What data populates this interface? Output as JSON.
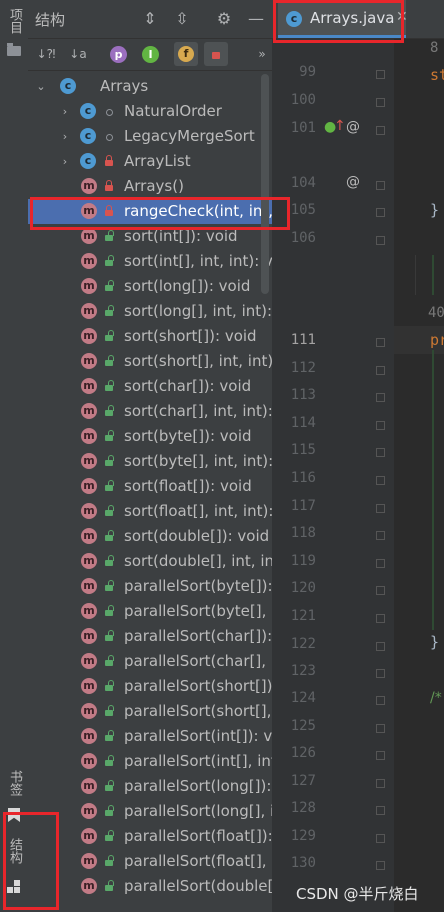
{
  "left_strip": {
    "project_label": "项目",
    "bookmarks_label": "书签",
    "structure_label": "结构"
  },
  "structure_panel": {
    "title": "结构",
    "header_icons": [
      "expand-all-icon",
      "collapse-all-icon",
      "gear-icon",
      "minimize-icon"
    ],
    "toolbar": {
      "sort_visibility_label": "↓⁈",
      "sort_alpha_label": "↓a",
      "show_properties": "p",
      "show_inherited": "I",
      "show_fields": "f",
      "show_non_public": "lock",
      "more": "»"
    },
    "root": {
      "label": "Arrays",
      "icon": "class-icon"
    },
    "items": [
      {
        "label": "NaturalOrder",
        "icon": "class-icon",
        "expandable": true,
        "visibility": "package"
      },
      {
        "label": "LegacyMergeSort",
        "icon": "class-icon",
        "expandable": true,
        "visibility": "package"
      },
      {
        "label": "ArrayList",
        "icon": "class-icon",
        "expandable": true,
        "visibility": "private"
      },
      {
        "label": "Arrays()",
        "icon": "method-icon",
        "expandable": false,
        "visibility": "private"
      },
      {
        "label": "rangeCheck(int, int, int): void",
        "icon": "method-icon",
        "expandable": false,
        "visibility": "private",
        "selected": true
      },
      {
        "label": "sort(int[]): void",
        "icon": "method-icon",
        "visibility": "public"
      },
      {
        "label": "sort(int[], int, int): void",
        "icon": "method-icon",
        "visibility": "public"
      },
      {
        "label": "sort(long[]): void",
        "icon": "method-icon",
        "visibility": "public"
      },
      {
        "label": "sort(long[], int, int): void",
        "icon": "method-icon",
        "visibility": "public"
      },
      {
        "label": "sort(short[]): void",
        "icon": "method-icon",
        "visibility": "public"
      },
      {
        "label": "sort(short[], int, int): void",
        "icon": "method-icon",
        "visibility": "public"
      },
      {
        "label": "sort(char[]): void",
        "icon": "method-icon",
        "visibility": "public"
      },
      {
        "label": "sort(char[], int, int): void",
        "icon": "method-icon",
        "visibility": "public"
      },
      {
        "label": "sort(byte[]): void",
        "icon": "method-icon",
        "visibility": "public"
      },
      {
        "label": "sort(byte[], int, int): void",
        "icon": "method-icon",
        "visibility": "public"
      },
      {
        "label": "sort(float[]): void",
        "icon": "method-icon",
        "visibility": "public"
      },
      {
        "label": "sort(float[], int, int): void",
        "icon": "method-icon",
        "visibility": "public"
      },
      {
        "label": "sort(double[]): void",
        "icon": "method-icon",
        "visibility": "public"
      },
      {
        "label": "sort(double[], int, int): void",
        "icon": "method-icon",
        "visibility": "public"
      },
      {
        "label": "parallelSort(byte[]): void",
        "icon": "method-icon",
        "visibility": "public"
      },
      {
        "label": "parallelSort(byte[], int, int): void",
        "icon": "method-icon",
        "visibility": "public"
      },
      {
        "label": "parallelSort(char[]): void",
        "icon": "method-icon",
        "visibility": "public"
      },
      {
        "label": "parallelSort(char[], int, int): void",
        "icon": "method-icon",
        "visibility": "public"
      },
      {
        "label": "parallelSort(short[]): void",
        "icon": "method-icon",
        "visibility": "public"
      },
      {
        "label": "parallelSort(short[], int, int): void",
        "icon": "method-icon",
        "visibility": "public"
      },
      {
        "label": "parallelSort(int[]): void",
        "icon": "method-icon",
        "visibility": "public"
      },
      {
        "label": "parallelSort(int[], int, int): void",
        "icon": "method-icon",
        "visibility": "public"
      },
      {
        "label": "parallelSort(long[]): void",
        "icon": "method-icon",
        "visibility": "public"
      },
      {
        "label": "parallelSort(long[], int, int): void",
        "icon": "method-icon",
        "visibility": "public"
      },
      {
        "label": "parallelSort(float[]): void",
        "icon": "method-icon",
        "visibility": "public"
      },
      {
        "label": "parallelSort(float[], int, int): void",
        "icon": "method-icon",
        "visibility": "public"
      },
      {
        "label": "parallelSort(double[]): void",
        "icon": "method-icon",
        "visibility": "public"
      }
    ]
  },
  "editor": {
    "tab": {
      "label": "Arrays.java",
      "icon": "class-icon"
    },
    "line_numbers": [
      "99",
      "100",
      "101",
      "104",
      "105",
      "106",
      "111",
      "112",
      "113",
      "114",
      "115",
      "116",
      "117",
      "118",
      "119",
      "120",
      "121",
      "122",
      "123",
      "124",
      "125",
      "126",
      "127",
      "128",
      "129",
      "130"
    ],
    "code_fragments": {
      "top_hint": "8",
      "line99": "st",
      "line105": "}",
      "hint_40": "40",
      "line111": "pr",
      "line122": "}",
      "line124": "/*"
    },
    "gutter_marks": {
      "override_up": "↑",
      "at_101": "@",
      "at_104": "@"
    }
  },
  "watermark": "CSDN @半斤烧白",
  "colors": {
    "selection": "#4b6eaf",
    "class_icon": "#4e9ad2",
    "method_icon": "#c27b86",
    "public_lock": "#59a869",
    "private_lock": "#d8544f",
    "annotation_box": "#e8262b",
    "keyword": "#cc7832"
  }
}
